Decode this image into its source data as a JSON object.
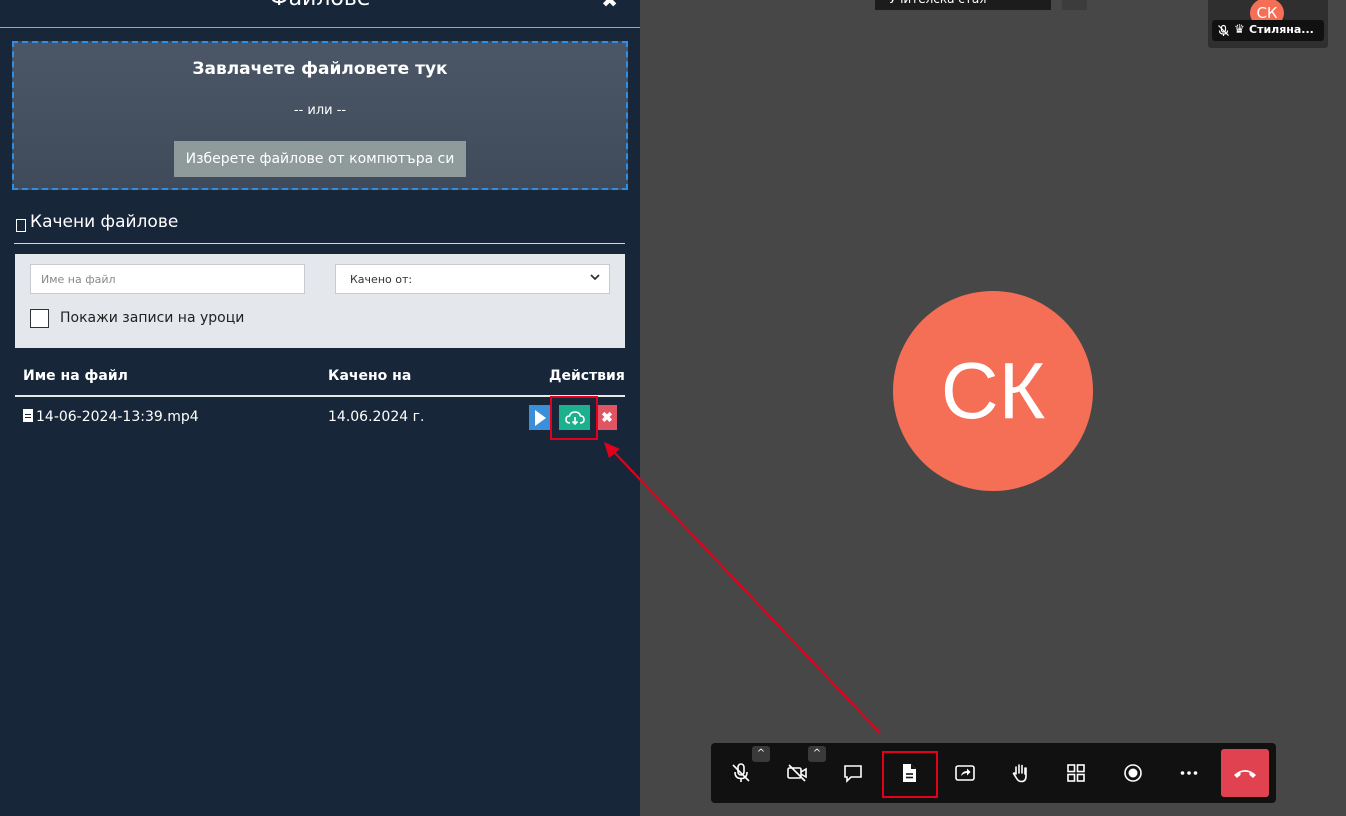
{
  "panel": {
    "title": "Файлове",
    "close_glyph": "✖",
    "dropzone": {
      "title": "Завлачете файловете тук",
      "or_text": "-- или --",
      "choose_button": "Изберете файлове от компютъра си"
    },
    "uploaded": {
      "title": "Качени файлове",
      "filters": {
        "filename_placeholder": "Име на файл",
        "uploaded_by_value": "Качено от:",
        "show_lesson_records_label": "Покажи записи на уроци"
      },
      "columns": {
        "filename": "Име на файл",
        "uploaded_on": "Качено на",
        "actions": "Действия"
      },
      "rows": [
        {
          "filename": "14-06-2024-13:39.mp4",
          "date": "14.06.2024 г.",
          "delete_glyph": "✖"
        }
      ]
    }
  },
  "meeting": {
    "top_tab_label": "Учителска стая",
    "thumbnail": {
      "initials": "СК",
      "crown_glyph": "♛",
      "name": "Стиляна..."
    },
    "main_avatar_initials": "СК",
    "toolbar": {
      "caret_glyph": "^",
      "icons": [
        "mic-muted-icon",
        "camera-off-icon",
        "chat-icon",
        "file-icon",
        "share-screen-icon",
        "raise-hand-icon",
        "tile-view-icon",
        "record-icon",
        "more-icon",
        "hangup-icon"
      ]
    }
  },
  "colors": {
    "panel_bg": "#18263a",
    "accent_blue": "#2f8de4",
    "download_green": "#1db08e",
    "play_blue": "#3b8fd9",
    "delete_red": "#e05563",
    "avatar_coral": "#f56f56",
    "highlight_red": "#e3001b",
    "hangup_red": "#e0424f"
  }
}
